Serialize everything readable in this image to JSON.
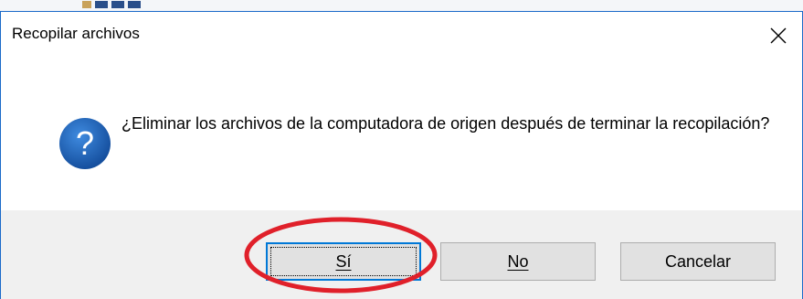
{
  "dialog": {
    "title": "Recopilar archivos",
    "close_icon": "close-icon",
    "message_icon": "question-icon",
    "message": "¿Eliminar los archivos de la computadora de origen después de terminar la recopilación?",
    "buttons": {
      "yes_label": "Sí",
      "no_label": "No",
      "cancel_label": "Cancelar"
    },
    "default_button": "yes"
  },
  "annotation": {
    "shape": "ellipse",
    "color": "#e0202a",
    "target": "yes-button"
  },
  "colors": {
    "accent": "#0078d7",
    "question_icon": "#1a5fb4",
    "footer": "#f0f0f0"
  }
}
